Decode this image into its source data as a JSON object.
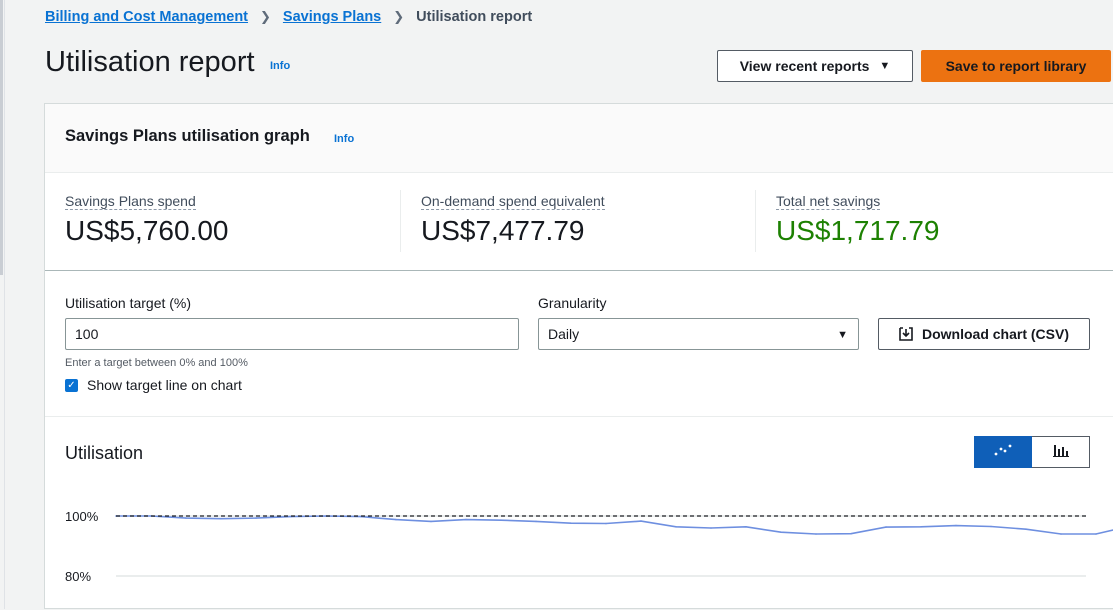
{
  "breadcrumb": {
    "items": [
      "Billing and Cost Management",
      "Savings Plans"
    ],
    "current": "Utilisation report"
  },
  "page": {
    "title": "Utilisation report",
    "info": "Info",
    "view_recent_label": "View recent reports",
    "save_label": "Save to report library"
  },
  "panel": {
    "title": "Savings Plans utilisation graph",
    "info": "Info"
  },
  "metrics": [
    {
      "label": "Savings Plans spend",
      "value": "US$5,760.00"
    },
    {
      "label": "On-demand spend equivalent",
      "value": "US$7,477.79"
    },
    {
      "label": "Total net savings",
      "value": "US$1,717.79"
    }
  ],
  "controls": {
    "target_label": "Utilisation target (%)",
    "target_value": "100",
    "target_hint": "Enter a target between 0% and 100%",
    "show_target_label": "Show target line on chart",
    "show_target_checked": true,
    "granularity_label": "Granularity",
    "granularity_value": "Daily",
    "download_label": "Download chart (CSV)"
  },
  "utilisation": {
    "title": "Utilisation",
    "view_toggle": [
      "line-chart-icon",
      "bar-chart-icon"
    ],
    "active_view": "line"
  },
  "chart_data": {
    "type": "line",
    "title": "",
    "xlabel": "",
    "ylabel": "",
    "y_ticks": [
      "100%",
      "80%"
    ],
    "ylim": [
      80,
      100
    ],
    "target_line": 100,
    "series": [
      {
        "values": [
          100,
          100,
          99.3,
          99.1,
          99.3,
          99.8,
          100,
          99.8,
          98.8,
          98.2,
          98.8,
          98.6,
          98.2,
          97.6,
          97.5,
          98.3,
          96.4,
          96,
          96.4,
          94.6,
          94,
          94.1,
          96.3,
          96.4,
          96.8,
          96.5,
          95.6,
          94,
          94,
          96.7
        ]
      }
    ],
    "colors": {
      "series": "#6e8fe0",
      "target": "#16191f",
      "grid": "#d5dbdb"
    }
  }
}
